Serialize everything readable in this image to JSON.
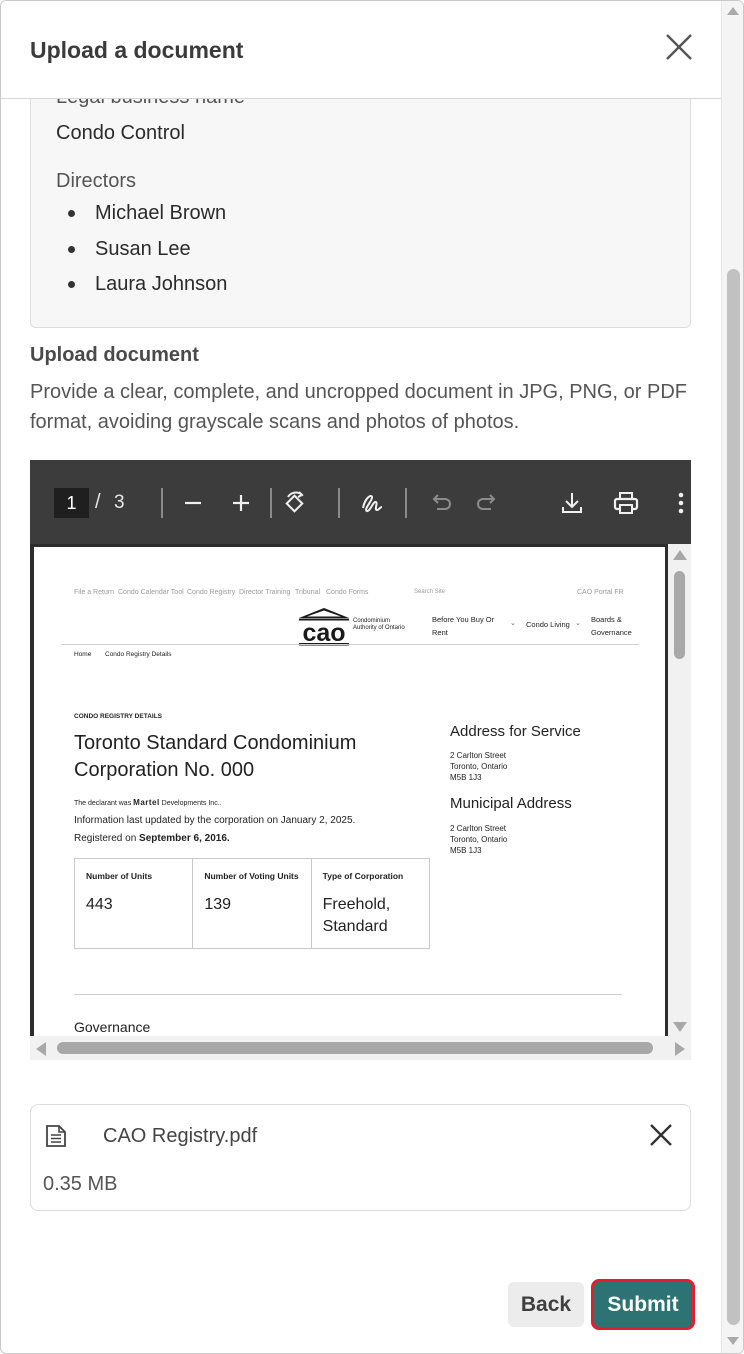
{
  "modal": {
    "title": "Upload a document",
    "close_icon": "close-icon"
  },
  "business": {
    "legal_label": "Legal business name",
    "legal_value": "Condo Control",
    "directors_label": "Directors",
    "directors": [
      "Michael Brown",
      "Susan Lee",
      "Laura Johnson"
    ]
  },
  "upload": {
    "title": "Upload document",
    "description": "Provide a clear, complete, and uncropped document in JPG, PNG, or PDF format, avoiding grayscale scans and photos of photos."
  },
  "pdf_viewer": {
    "current_page": "1",
    "page_separator": "/",
    "total_pages": "3",
    "toolbar_icons": [
      "zoom-out-icon",
      "zoom-in-icon",
      "rotate-icon",
      "annotate-icon",
      "undo-icon",
      "redo-icon",
      "download-icon",
      "print-icon",
      "more-options-icon"
    ],
    "document": {
      "top_links": [
        "File a Return",
        "Condo Calendar Tool",
        "Condo Registry",
        "Director Training",
        "Tribunal",
        "Condo Forms"
      ],
      "search_label": "Search Site",
      "portal_links": "CAO Portal   FR",
      "logo_text": "cao",
      "logo_caption": "Condominium Authority of Ontario",
      "nav_items": [
        "Before You Buy Or Rent",
        "Condo Living",
        "Boards & Governance"
      ],
      "breadcrumb_home": "Home",
      "breadcrumb_current": "Condo Registry Details",
      "section_label": "CONDO REGISTRY DETAILS",
      "heading_line1": "Toronto Standard Condominium",
      "heading_line2": "Corporation No. 000",
      "declarant_prefix": "The declarant was",
      "declarant_name": "Martel",
      "declarant_suffix": "Developments Inc..",
      "last_updated": "Information last updated by the corporation on January 2, 2025.",
      "registered_prefix": "Registered on",
      "registered_date": "September 6, 2016.",
      "address_service_title": "Address for Service",
      "address_service": [
        "2 Carlton Street",
        "Toronto, Ontario",
        "M5B 1J3"
      ],
      "municipal_title": "Municipal Address",
      "municipal_address": [
        "2 Carlton Street",
        "Toronto, Ontario",
        "M5B 1J3"
      ],
      "table": [
        {
          "header": "Number of Units",
          "value": "443"
        },
        {
          "header": "Number of Voting Units",
          "value": "139"
        },
        {
          "header": "Type of Corporation",
          "value": "Freehold, Standard"
        }
      ],
      "governance_title": "Governance"
    }
  },
  "file": {
    "icon": "document-file-icon",
    "name": "CAO Registry.pdf",
    "size": "0.35 MB"
  },
  "actions": {
    "back_label": "Back",
    "submit_label": "Submit"
  },
  "colors": {
    "submit_bg": "#2d7374",
    "submit_border": "#e0202a",
    "toolbar_bg": "#3c3c3c"
  }
}
